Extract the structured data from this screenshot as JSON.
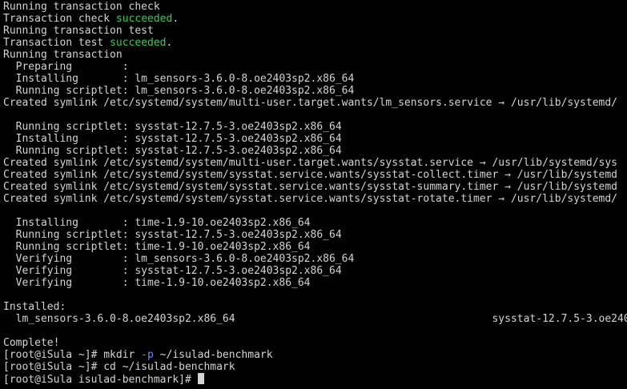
{
  "colors": {
    "background": "#000000",
    "foreground": "#d4d4d4",
    "success": "#43c85a",
    "flag": "#5a8fff"
  },
  "terminal": {
    "lines": [
      [
        {
          "text": "Running transaction check"
        }
      ],
      [
        {
          "text": "Transaction check "
        },
        {
          "text": "succeeded",
          "style": "ok"
        },
        {
          "text": "."
        }
      ],
      [
        {
          "text": "Running transaction test"
        }
      ],
      [
        {
          "text": "Transaction test "
        },
        {
          "text": "succeeded",
          "style": "ok"
        },
        {
          "text": "."
        }
      ],
      [
        {
          "text": "Running transaction"
        }
      ],
      [
        {
          "text": "  Preparing        :"
        }
      ],
      [
        {
          "text": "  Installing       : lm_sensors-3.6.0-8.oe2403sp2.x86_64"
        }
      ],
      [
        {
          "text": "  Running scriptlet: lm_sensors-3.6.0-8.oe2403sp2.x86_64"
        }
      ],
      [
        {
          "text": "Created symlink /etc/systemd/system/multi-user.target.wants/lm_sensors.service → /usr/lib/systemd/"
        }
      ],
      [
        {
          "text": ""
        }
      ],
      [
        {
          "text": "  Running scriptlet: sysstat-12.7.5-3.oe2403sp2.x86_64"
        }
      ],
      [
        {
          "text": "  Installing       : sysstat-12.7.5-3.oe2403sp2.x86_64"
        }
      ],
      [
        {
          "text": "  Running scriptlet: sysstat-12.7.5-3.oe2403sp2.x86_64"
        }
      ],
      [
        {
          "text": "Created symlink /etc/systemd/system/multi-user.target.wants/sysstat.service → /usr/lib/systemd/sys"
        }
      ],
      [
        {
          "text": "Created symlink /etc/systemd/system/sysstat.service.wants/sysstat-collect.timer → /usr/lib/systemd"
        }
      ],
      [
        {
          "text": "Created symlink /etc/systemd/system/sysstat.service.wants/sysstat-summary.timer → /usr/lib/systemd"
        }
      ],
      [
        {
          "text": "Created symlink /etc/systemd/system/sysstat.service.wants/sysstat-rotate.timer → /usr/lib/systemd/"
        }
      ],
      [
        {
          "text": ""
        }
      ],
      [
        {
          "text": "  Installing       : time-1.9-10.oe2403sp2.x86_64"
        }
      ],
      [
        {
          "text": "  Running scriptlet: sysstat-12.7.5-3.oe2403sp2.x86_64"
        }
      ],
      [
        {
          "text": "  Running scriptlet: time-1.9-10.oe2403sp2.x86_64"
        }
      ],
      [
        {
          "text": "  Verifying        : lm_sensors-3.6.0-8.oe2403sp2.x86_64"
        }
      ],
      [
        {
          "text": "  Verifying        : sysstat-12.7.5-3.oe2403sp2.x86_64"
        }
      ],
      [
        {
          "text": "  Verifying        : time-1.9-10.oe2403sp2.x86_64"
        }
      ],
      [
        {
          "text": ""
        }
      ],
      [
        {
          "text": "Installed:"
        }
      ],
      [
        {
          "text": "  lm_sensors-3.6.0-8.oe2403sp2.x86_64                                         sysstat-12.7.5-3.oe2403sp"
        }
      ],
      [
        {
          "text": ""
        }
      ],
      [
        {
          "text": "Complete!"
        }
      ],
      [
        {
          "text": "[root@iSula ~]# mkdir "
        },
        {
          "text": "-p",
          "style": "flag"
        },
        {
          "text": " ~/isulad-benchmark"
        }
      ],
      [
        {
          "text": "[root@iSula ~]# cd ~/isulad-benchmark"
        }
      ],
      [
        {
          "text": "[root@iSula isulad-benchmark]# "
        },
        {
          "text": "",
          "style": "cursor"
        }
      ]
    ]
  }
}
